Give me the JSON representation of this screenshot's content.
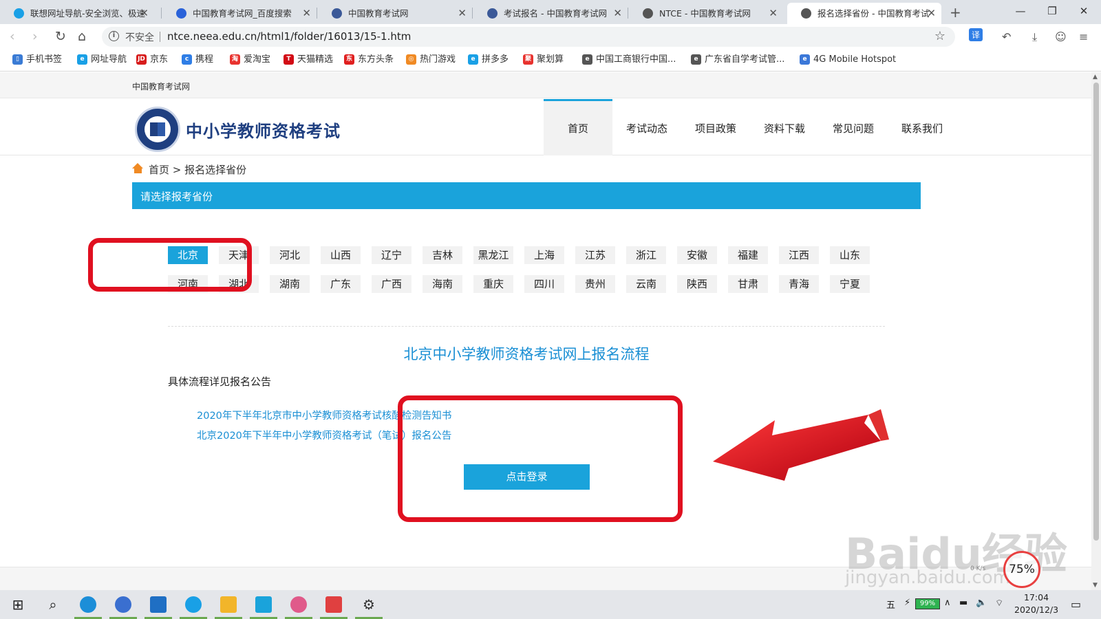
{
  "browser": {
    "tabs": [
      {
        "title": "联想网址导航-安全浏览、极速",
        "icon_color": "#19a0e6"
      },
      {
        "title": "中国教育考试网_百度搜索",
        "icon_color": "#2a62d9"
      },
      {
        "title": "中国教育考试网",
        "icon_color": "#3b5998"
      },
      {
        "title": "考试报名 - 中国教育考试网",
        "icon_color": "#3b5998"
      },
      {
        "title": "NTCE - 中国教育考试网",
        "icon_color": "#555555"
      },
      {
        "title": "报名选择省份 - 中国教育考试",
        "icon_color": "#555555"
      }
    ],
    "new_tab": "+",
    "window_controls": {
      "minimize": "—",
      "maximize": "❐",
      "close": "✕"
    },
    "address": {
      "security_label": "不安全",
      "url": "ntce.neea.edu.cn/html1/folder/16013/15-1.htm"
    },
    "toolbar_translate": "译",
    "bookmarks": [
      {
        "label": "手机书签",
        "icon_color": "#3a7bd5",
        "icon": "▯"
      },
      {
        "label": "网址导航",
        "icon_color": "#19a0e6",
        "icon": "e"
      },
      {
        "label": "京东",
        "icon_color": "#d71c1c",
        "icon": "JD"
      },
      {
        "label": "携程",
        "icon_color": "#2f7ee6",
        "icon": "c"
      },
      {
        "label": "爱淘宝",
        "icon_color": "#e8322e",
        "icon": "淘"
      },
      {
        "label": "天猫精选",
        "icon_color": "#d20a14",
        "icon": "T"
      },
      {
        "label": "东方头条",
        "icon_color": "#e02020",
        "icon": "东"
      },
      {
        "label": "热门游戏",
        "icon_color": "#f08a24",
        "icon": "◎"
      },
      {
        "label": "拼多多",
        "icon_color": "#19a0e6",
        "icon": "e"
      },
      {
        "label": "聚划算",
        "icon_color": "#e8322e",
        "icon": "聚"
      },
      {
        "label": "中国工商银行中国...",
        "icon_color": "#555555",
        "icon": "e"
      },
      {
        "label": "广东省自学考试管...",
        "icon_color": "#555555",
        "icon": "e"
      },
      {
        "label": "4G Mobile Hotspot",
        "icon_color": "#3b78d8",
        "icon": "e"
      }
    ]
  },
  "page": {
    "topbar_text": "中国教育考试网",
    "site_title": "中小学教师资格考试",
    "nav": [
      "首页",
      "考试动态",
      "项目政策",
      "资料下载",
      "常见问题",
      "联系我们"
    ],
    "breadcrumb": {
      "home": "首页",
      "separator": ">",
      "current": "报名选择省份"
    },
    "province_bar_title": "请选择报考省份",
    "provinces_row1": [
      "北京",
      "天津",
      "河北",
      "山西",
      "辽宁",
      "吉林",
      "黑龙江",
      "上海",
      "江苏",
      "浙江",
      "安徽",
      "福建",
      "江西",
      "山东"
    ],
    "provinces_row2": [
      "河南",
      "湖北",
      "湖南",
      "广东",
      "广西",
      "海南",
      "重庆",
      "四川",
      "贵州",
      "云南",
      "陕西",
      "甘肃",
      "青海",
      "宁夏"
    ],
    "selected_province": "北京",
    "flow_title": "北京中小学教师资格考试网上报名流程",
    "detail_label": "具体流程详见报名公告",
    "notices": [
      "2020年下半年北京市中小学教师资格考试核酸检测告知书",
      "北京2020年下半年中小学教师资格考试（笔试）报名公告"
    ],
    "login_button": "点击登录"
  },
  "watermark": {
    "brand": "Baidu经验",
    "domain": "jingyan.baidu.com",
    "speed_percent": "75%",
    "speed_rate": "0 K/s"
  },
  "colors": {
    "accent": "#1aa3db",
    "link": "#1a8fd4",
    "annotation": "#e01020",
    "title_blue": "#1f3f80"
  },
  "taskbar": {
    "apps": [
      "windows-start",
      "search",
      "edge",
      "lenovo",
      "mail",
      "browser",
      "file-explorer",
      "store",
      "paint",
      "recorder",
      "settings"
    ],
    "ime": "五",
    "battery": "99%",
    "time": "17:04",
    "date": "2020/12/3"
  }
}
